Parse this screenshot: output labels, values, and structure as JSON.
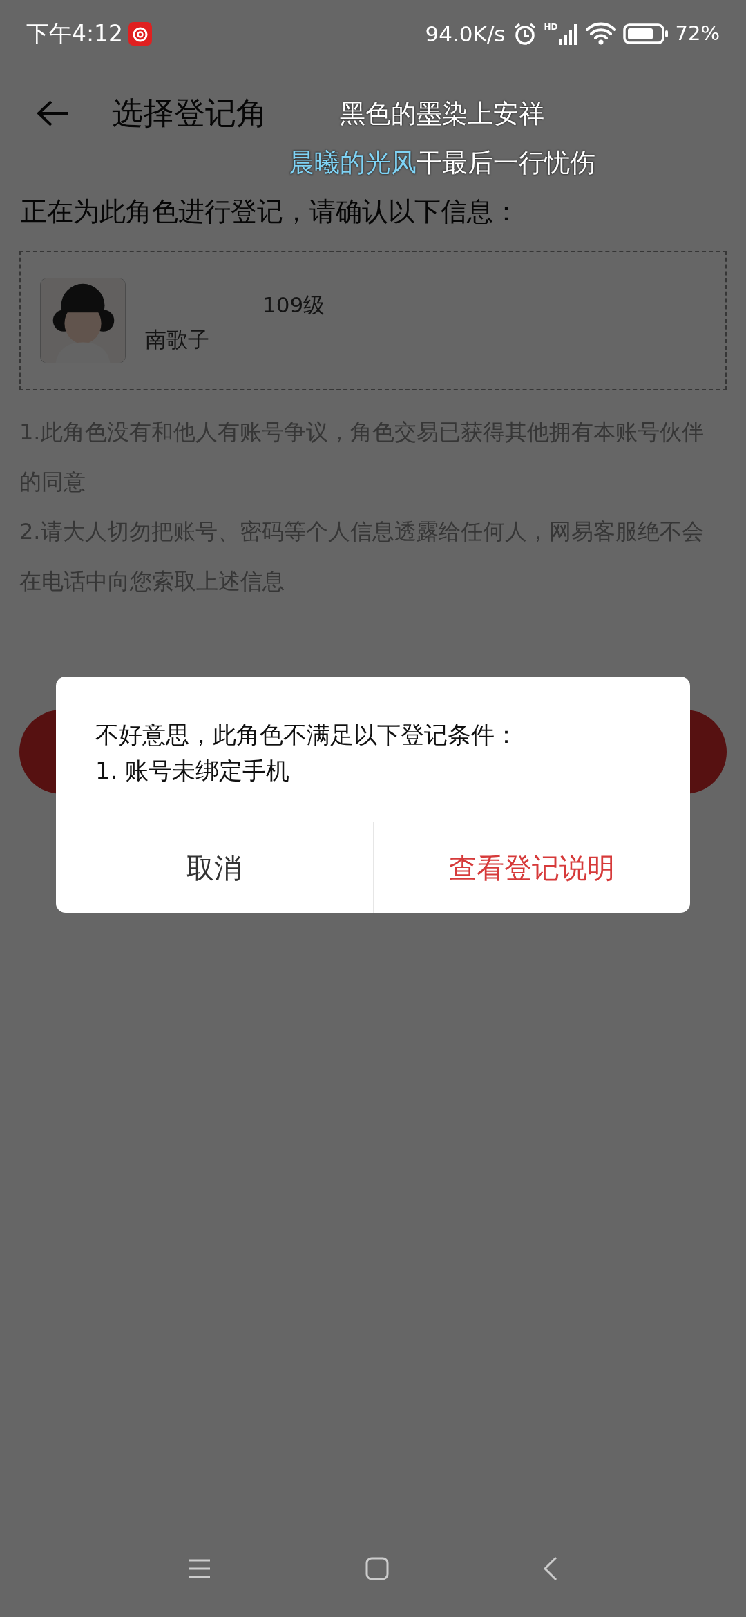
{
  "status_bar": {
    "time": "下午4:12",
    "net_speed": "94.0K/s",
    "signal_label": "HD",
    "battery": "72%"
  },
  "header": {
    "title": "选择登记角"
  },
  "lyrics": [
    {
      "text": "黑色的墨染上安祥"
    },
    {
      "sung": "晨曦的光风",
      "rest": "干最后一行忧伤"
    }
  ],
  "prompt": "正在为此角色进行登记，请确认以下信息：",
  "character": {
    "name": "南歌子",
    "grade": "109级"
  },
  "notes": [
    "1.此角色没有和他人有账号争议，角色交易已获得其他拥有本账号伙伴的同意",
    "2.请大人切勿把账号、密码等个人信息透露给任何人，网易客服绝不会在电话中向您索取上述信息"
  ],
  "dialog": {
    "message": "不好意思，此角色不满足以下登记条件：",
    "conditions": [
      "1. 账号未绑定手机"
    ],
    "buttons": [
      {
        "label": "取消",
        "kind": "cancel"
      },
      {
        "label": "查看登记说明",
        "kind": "primary"
      }
    ]
  }
}
